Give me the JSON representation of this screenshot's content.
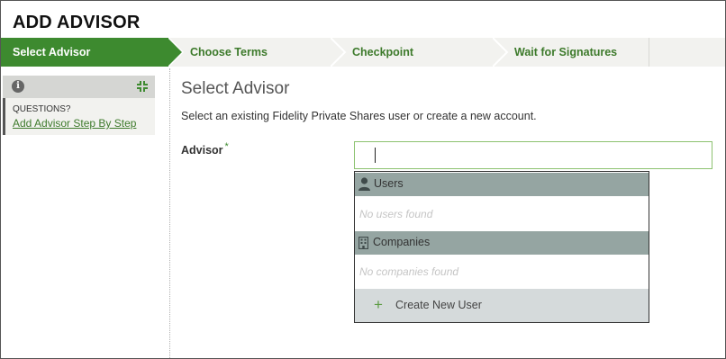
{
  "page": {
    "title": "ADD ADVISOR"
  },
  "stepper": {
    "steps": [
      {
        "label": "Select Advisor",
        "active": true
      },
      {
        "label": "Choose Terms",
        "active": false
      },
      {
        "label": "Checkpoint",
        "active": false
      },
      {
        "label": "Wait for Signatures",
        "active": false
      }
    ],
    "active_color": "#3d8a2f",
    "inactive_text_color": "#3d7a2b"
  },
  "sidebar": {
    "icons": {
      "info": "info-icon",
      "collapse": "compress-icon"
    },
    "questions_label": "QUESTIONS?",
    "help_link": "Add Advisor Step By Step"
  },
  "main": {
    "title": "Select Advisor",
    "description": "Select an existing Fidelity Private Shares user or create a new account.",
    "advisor_field": {
      "label": "Advisor",
      "required_marker": "*",
      "value": ""
    }
  },
  "dropdown": {
    "users_group": {
      "icon": "person-icon",
      "label": "Users",
      "empty_text": "No users found"
    },
    "companies_group": {
      "icon": "building-icon",
      "label": "Companies",
      "empty_text": "No companies found"
    },
    "create_action": {
      "icon": "plus-icon",
      "symbol": "+",
      "label": "Create New User"
    }
  }
}
